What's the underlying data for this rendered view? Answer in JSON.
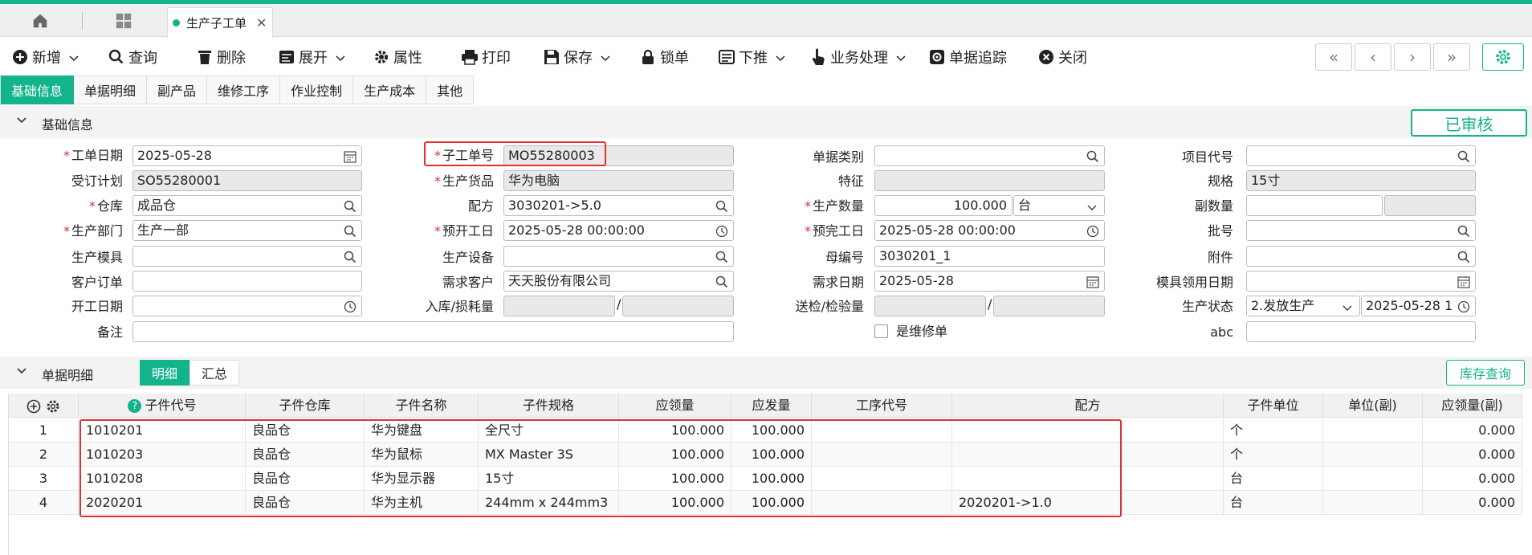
{
  "tabs": {
    "active_label": "生产子工单"
  },
  "toolbar": {
    "new": "新增",
    "query": "查询",
    "delete": "删除",
    "expand": "展开",
    "props": "属性",
    "print": "打印",
    "save": "保存",
    "lock": "锁单",
    "push": "下推",
    "business": "业务处理",
    "trace": "单据追踪",
    "close": "关闭"
  },
  "subtabs": [
    "基础信息",
    "单据明细",
    "副产品",
    "维修工序",
    "作业控制",
    "生产成本",
    "其他"
  ],
  "basic": {
    "title": "基础信息",
    "status": "已审核",
    "fields": {
      "work_date_label": "工单日期",
      "work_date": "2025-05-28",
      "order_plan_label": "受订计划",
      "order_plan": "SO55280001",
      "warehouse_label": "仓库",
      "warehouse": "成品仓",
      "dept_label": "生产部门",
      "dept": "生产一部",
      "mold_label": "生产模具",
      "mold": "",
      "customer_order_label": "客户订单",
      "customer_order": "",
      "start_date_label": "开工日期",
      "start_date": "",
      "remark_label": "备注",
      "remark": "",
      "sub_no_label": "子工单号",
      "sub_no": "MO55280003",
      "product_label": "生产货品",
      "product": "华为电脑",
      "formula_label": "配方",
      "formula": "3030201->5.0",
      "plan_start_label": "预开工日",
      "plan_start": "2025-05-28 00:00:00",
      "equipment_label": "生产设备",
      "equipment": "",
      "demand_customer_label": "需求客户",
      "demand_customer": "天天股份有限公司",
      "in_loss_label": "入库/损耗量",
      "in_qty": "",
      "loss_qty": "",
      "doc_type_label": "单据类别",
      "doc_type": "",
      "feature_label": "特征",
      "feature": "",
      "prod_qty_label": "生产数量",
      "prod_qty": "100.000",
      "prod_unit": "台",
      "plan_end_label": "预完工日",
      "plan_end": "2025-05-28 00:00:00",
      "parent_no_label": "母编号",
      "parent_no": "3030201_1",
      "demand_date_label": "需求日期",
      "demand_date": "2025-05-28",
      "inspect_label": "送检/检验量",
      "inspect_a": "",
      "inspect_b": "",
      "is_repair_label": "是维修单",
      "project_label": "项目代号",
      "project": "",
      "spec_label": "规格",
      "spec": "15寸",
      "sub_qty_label": "副数量",
      "sub_qty": "",
      "sub_qty2": "",
      "batch_label": "批号",
      "batch": "",
      "attach_label": "附件",
      "attach": "",
      "mold_date_label": "模具领用日期",
      "mold_date": "",
      "prod_status_label": "生产状态",
      "prod_status": "2.发放生产",
      "prod_status_date": "2025-05-28 1",
      "abc_label": "abc",
      "abc": ""
    }
  },
  "detail": {
    "title": "单据明细",
    "tab_detail": "明细",
    "tab_summary": "汇总",
    "stock_query": "库存查询",
    "columns": [
      "子件代号",
      "子件仓库",
      "子件名称",
      "子件规格",
      "应领量",
      "应发量",
      "工序代号",
      "配方",
      "子件单位",
      "单位(副)",
      "应领量(副)"
    ],
    "rows": [
      {
        "no": "1",
        "code": "1010201",
        "wh": "良品仓",
        "name": "华为键盘",
        "spec": "全尺寸",
        "need": "100.000",
        "issue": "100.000",
        "proc": "",
        "formula": "",
        "unit": "个",
        "unit2": "",
        "need2": "0.000"
      },
      {
        "no": "2",
        "code": "1010203",
        "wh": "良品仓",
        "name": "华为鼠标",
        "spec": "MX Master 3S",
        "need": "100.000",
        "issue": "100.000",
        "proc": "",
        "formula": "",
        "unit": "个",
        "unit2": "",
        "need2": "0.000"
      },
      {
        "no": "3",
        "code": "1010208",
        "wh": "良品仓",
        "name": "华为显示器",
        "spec": "15寸",
        "need": "100.000",
        "issue": "100.000",
        "proc": "",
        "formula": "",
        "unit": "台",
        "unit2": "",
        "need2": "0.000"
      },
      {
        "no": "4",
        "code": "2020201",
        "wh": "良品仓",
        "name": "华为主机",
        "spec": "244mm x 244mm3",
        "need": "100.000",
        "issue": "100.000",
        "proc": "",
        "formula": "2020201->1.0",
        "unit": "台",
        "unit2": "",
        "need2": "0.000"
      }
    ]
  },
  "colors": {
    "accent": "#13b38b",
    "required": "#e03030",
    "highlight": "#e03030"
  }
}
